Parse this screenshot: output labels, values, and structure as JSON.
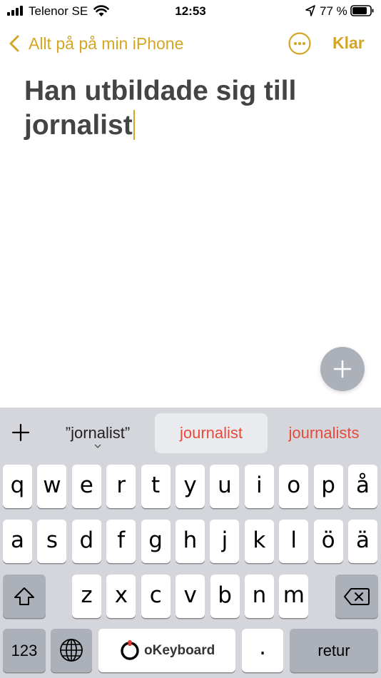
{
  "status_bar": {
    "carrier": "Telenor SE",
    "time": "12:53",
    "battery_percent": "77 %",
    "signal_icon": "cell-signal-icon",
    "wifi_icon": "wifi-icon",
    "location_icon": "location-arrow-icon",
    "battery_icon": "battery-icon"
  },
  "nav": {
    "back_label": "Allt på på min iPhone",
    "done_label": "Klar",
    "accent_color": "#d4a626"
  },
  "note": {
    "title_line1": "Han utbildade sig till",
    "title_line2": "jornalist"
  },
  "predictions": {
    "items": [
      "”jornalist”",
      "journalist",
      "journalists"
    ],
    "highlight_color": "#e54b3c"
  },
  "keyboard": {
    "row1": [
      "q",
      "w",
      "e",
      "r",
      "t",
      "y",
      "u",
      "i",
      "o",
      "p",
      "å"
    ],
    "row2": [
      "a",
      "s",
      "d",
      "f",
      "g",
      "h",
      "j",
      "k",
      "l",
      "ö",
      "ä"
    ],
    "row3": [
      "z",
      "x",
      "c",
      "v",
      "b",
      "n",
      "m"
    ],
    "numbers_label": "123",
    "space_label": "oKeyboard",
    "period_label": ".",
    "return_label": "retur"
  }
}
